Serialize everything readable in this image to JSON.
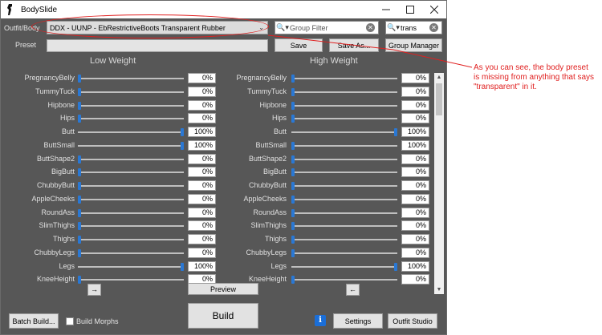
{
  "window": {
    "title": "BodySlide",
    "controls": [
      "minimize",
      "maximize",
      "close"
    ]
  },
  "toolbar": {
    "outfit_label": "Outfit/Body",
    "outfit_value": "DDX - UUNP - EbRestrictiveBoots Transparent Rubber",
    "group_filter_placeholder": "Group Filter",
    "outfit_filter_value": "trans",
    "preset_label": "Preset",
    "preset_value": "",
    "save_label": "Save",
    "save_as_label": "Save As...",
    "group_manager_label": "Group Manager"
  },
  "columns": {
    "low": "Low Weight",
    "high": "High Weight"
  },
  "sliders": [
    {
      "label": "PregnancyBelly",
      "low": 0,
      "high": 0,
      "low_text": "0%",
      "high_text": "0%"
    },
    {
      "label": "TummyTuck",
      "low": 0,
      "high": 0,
      "low_text": "0%",
      "high_text": "0%"
    },
    {
      "label": "Hipbone",
      "low": 0,
      "high": 0,
      "low_text": "0%",
      "high_text": "0%"
    },
    {
      "label": "Hips",
      "low": 0,
      "high": 0,
      "low_text": "0%",
      "high_text": "0%"
    },
    {
      "label": "Butt",
      "low": 100,
      "high": 100,
      "low_text": "100%",
      "high_text": "100%"
    },
    {
      "label": "ButtSmall",
      "low": 100,
      "high": 0,
      "low_text": "100%",
      "high_text": "100%"
    },
    {
      "label": "ButtShape2",
      "low": 0,
      "high": 0,
      "low_text": "0%",
      "high_text": "0%"
    },
    {
      "label": "BigButt",
      "low": 0,
      "high": 0,
      "low_text": "0%",
      "high_text": "0%"
    },
    {
      "label": "ChubbyButt",
      "low": 0,
      "high": 0,
      "low_text": "0%",
      "high_text": "0%"
    },
    {
      "label": "AppleCheeks",
      "low": 0,
      "high": 0,
      "low_text": "0%",
      "high_text": "0%"
    },
    {
      "label": "RoundAss",
      "low": 0,
      "high": 0,
      "low_text": "0%",
      "high_text": "0%"
    },
    {
      "label": "SlimThighs",
      "low": 0,
      "high": 0,
      "low_text": "0%",
      "high_text": "0%"
    },
    {
      "label": "Thighs",
      "low": 0,
      "high": 0,
      "low_text": "0%",
      "high_text": "0%"
    },
    {
      "label": "ChubbyLegs",
      "low": 0,
      "high": 0,
      "low_text": "0%",
      "high_text": "0%"
    },
    {
      "label": "Legs",
      "low": 100,
      "high": 100,
      "low_text": "100%",
      "high_text": "100%"
    },
    {
      "label": "KneeHeight",
      "low": 0,
      "high": 0,
      "low_text": "0%",
      "high_text": "0%"
    }
  ],
  "nav": {
    "right_arrow": "→",
    "left_arrow": "←",
    "preview_label": "Preview"
  },
  "bottom": {
    "batch_build_label": "Batch Build...",
    "build_morphs_label": "Build Morphs",
    "build_label": "Build",
    "info_glyph": "i",
    "settings_label": "Settings",
    "outfit_studio_label": "Outfit Studio"
  },
  "annotation": {
    "text": "As you can see, the body preset is missing from anything that says \"transparent\" in it.",
    "color": "#e02020"
  },
  "colors": {
    "accent": "#2a78d4",
    "panel": "#575757",
    "annotation": "#e02020"
  }
}
